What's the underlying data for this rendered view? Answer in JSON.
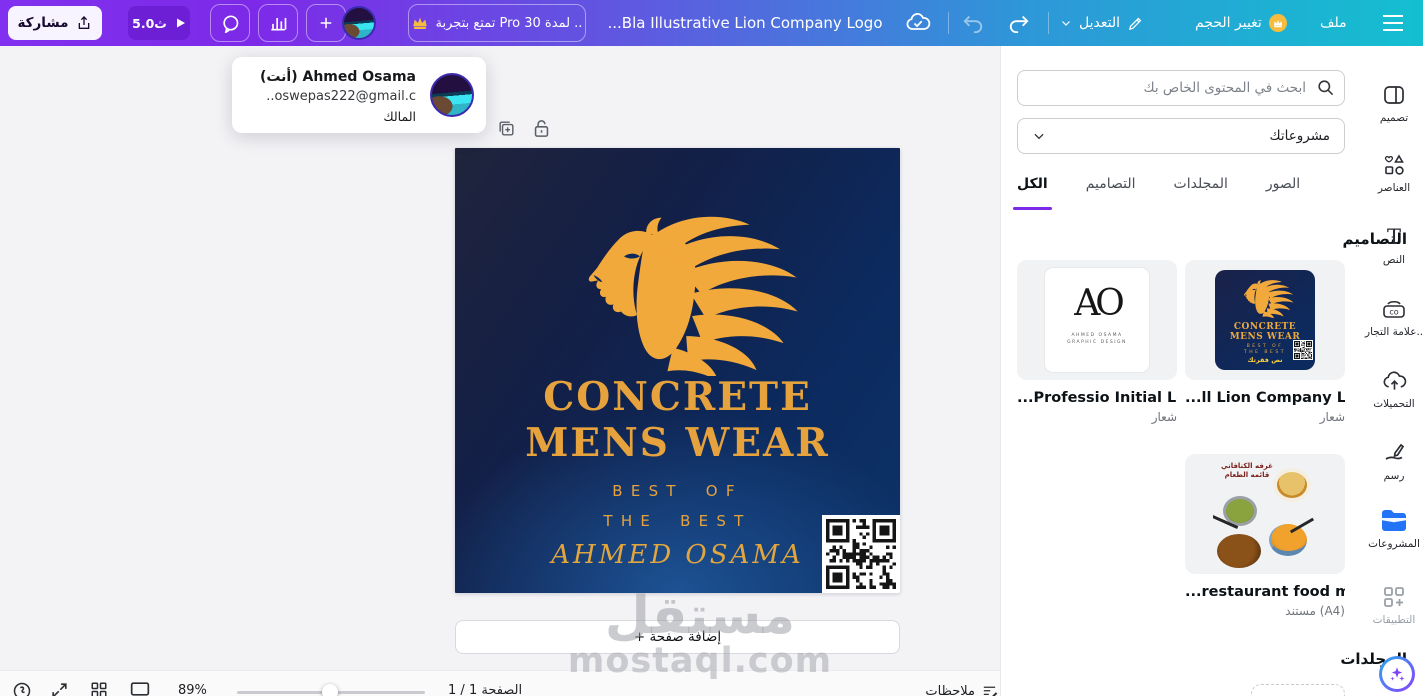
{
  "toolbar": {
    "share": "مشاركة",
    "duration": "5.0ث",
    "pro_trial": "تمتع بتجربة Pro لمدة 30 ..",
    "title": "...Bla Illustrative Lion Company Logo",
    "edit": "التعديل",
    "resize": "تغيير الحجم",
    "file": "ملف"
  },
  "owner_tooltip": {
    "name": "Ahmed Osama (أنت)",
    "email": "..oswepas222@gmail.c",
    "role": "المالك"
  },
  "canvas": {
    "title_line1": "CONCRETE",
    "title_line2": "MENS WEAR",
    "sub_line1": "BEST OF",
    "sub_line2": "THE BEST",
    "signature": "AHMED OSAMA",
    "add_page": "+ إضافة صفحة"
  },
  "watermark": {
    "ar": "مستقل",
    "en": "mostaql.com"
  },
  "panel": {
    "search_placeholder": "ابحث في المحتوى الخاص بك",
    "dropdown": "مشروعاتك",
    "tabs": [
      "الكل",
      "التصاميم",
      "المجلدات",
      "الصور"
    ],
    "designs_heading": "التصاميم",
    "folders_heading": "المجلدات",
    "cards": [
      {
        "title": "...ll Lion Company Logo",
        "type": "شعار"
      },
      {
        "title": "...Professio Initial Logo",
        "type": "شعار"
      },
      {
        "title": "...restaurant food menu",
        "type": "مستند (A4)"
      }
    ],
    "lion_thumb": {
      "line1": "CONCRETE",
      "line2": "MENS WEAR",
      "line3": "BEST OF",
      "line4": "THE BEST",
      "line5": "نص فقرتك"
    },
    "ao_thumb": {
      "monogram": "AO",
      "line1": "AHMED OSAMA",
      "line2": "GRAPHIC DESIGN"
    },
    "food_thumb": {
      "line1": "غرفه الكنافاني",
      "line2": "قائمه الطعام"
    }
  },
  "rail": {
    "items": [
      {
        "label": "تصميم"
      },
      {
        "label": "العناصر"
      },
      {
        "label": "النص"
      },
      {
        "label": "علامة التجار.."
      },
      {
        "label": "التحميلات"
      },
      {
        "label": "رسم"
      },
      {
        "label": "المشروعات"
      },
      {
        "label": "التطبيقات"
      }
    ]
  },
  "footer": {
    "zoom": "89%",
    "page": "الصفحة 1 / 1",
    "notes": "ملاحظات"
  },
  "colors": {
    "toolbar_gradient_start": "#7d2ae8",
    "toolbar_gradient_end": "#14bfd0",
    "accent_purple": "#7d2ae8",
    "gold": "#E6A23C",
    "canvas_navy": "#0D2A5C",
    "projects_blue": "#2273F5",
    "crown_yellow": "#F7BC3D"
  }
}
